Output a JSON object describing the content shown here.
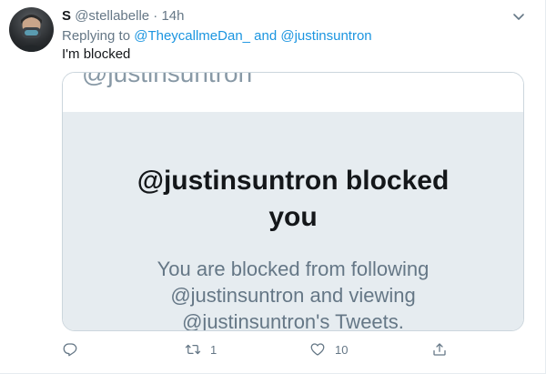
{
  "tweet": {
    "display_name": "S",
    "handle": "@stellabelle",
    "separator": "·",
    "time": "14h",
    "replying_prefix": "Replying to",
    "reply_user1": "@TheycallmeDan_",
    "reply_and": "and",
    "reply_user2": "@justinsuntron",
    "text": "I'm blocked",
    "media": {
      "cutoff_text": "@justinsuntron",
      "title_line1": "@justinsuntron blocked",
      "title_line2": "you",
      "sub_line1": "You are blocked from following",
      "sub_line2": "@justinsuntron and viewing",
      "sub_line3": "@justinsuntron's Tweets."
    },
    "actions": {
      "reply_icon": "reply-icon",
      "retweet_icon": "retweet-icon",
      "retweet_count": "1",
      "like_icon": "heart-icon",
      "like_count": "10",
      "share_icon": "share-icon"
    }
  },
  "colors": {
    "link": "#1b95e0",
    "secondary_text": "#657786",
    "media_bg": "#e6ecf0"
  }
}
